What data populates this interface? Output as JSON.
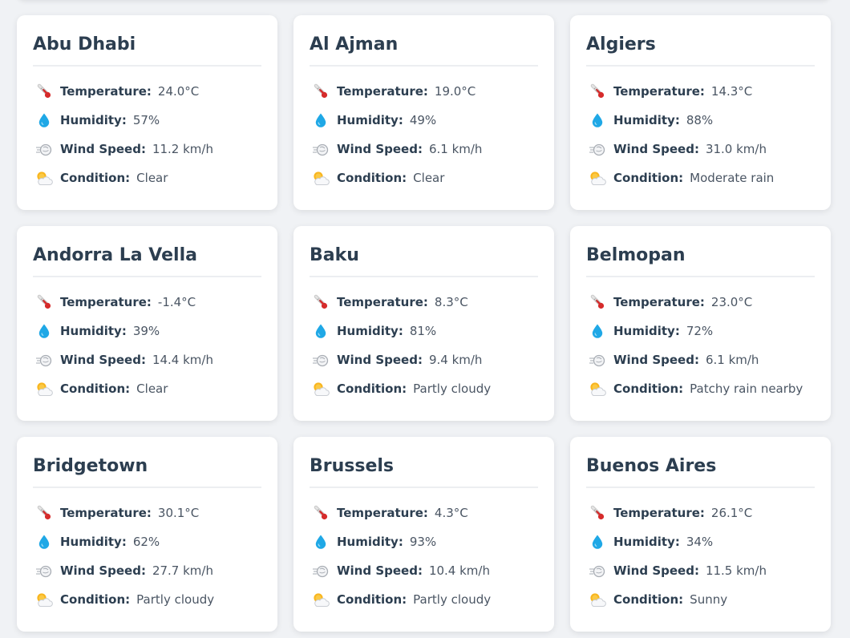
{
  "labels": {
    "temperature": "Temperature:",
    "humidity": "Humidity:",
    "wind_speed": "Wind Speed:",
    "condition": "Condition:"
  },
  "icons": {
    "temperature": "thermometer-icon",
    "humidity": "droplet-icon",
    "wind_speed": "wind-icon",
    "condition": "sun-behind-cloud-icon"
  },
  "colors": {
    "background": "#f0f2f5",
    "card": "#ffffff",
    "heading": "#2c3e50"
  },
  "cities": [
    {
      "name": "Abu Dhabi",
      "temperature": "24.0°C",
      "humidity": "57%",
      "wind_speed": "11.2 km/h",
      "condition": "Clear"
    },
    {
      "name": "Al Ajman",
      "temperature": "19.0°C",
      "humidity": "49%",
      "wind_speed": "6.1 km/h",
      "condition": "Clear"
    },
    {
      "name": "Algiers",
      "temperature": "14.3°C",
      "humidity": "88%",
      "wind_speed": "31.0 km/h",
      "condition": "Moderate rain"
    },
    {
      "name": "Andorra La Vella",
      "temperature": "-1.4°C",
      "humidity": "39%",
      "wind_speed": "14.4 km/h",
      "condition": "Clear"
    },
    {
      "name": "Baku",
      "temperature": "8.3°C",
      "humidity": "81%",
      "wind_speed": "9.4 km/h",
      "condition": "Partly cloudy"
    },
    {
      "name": "Belmopan",
      "temperature": "23.0°C",
      "humidity": "72%",
      "wind_speed": "6.1 km/h",
      "condition": "Patchy rain nearby"
    },
    {
      "name": "Bridgetown",
      "temperature": "30.1°C",
      "humidity": "62%",
      "wind_speed": "27.7 km/h",
      "condition": "Partly cloudy"
    },
    {
      "name": "Brussels",
      "temperature": "4.3°C",
      "humidity": "93%",
      "wind_speed": "10.4 km/h",
      "condition": "Partly cloudy"
    },
    {
      "name": "Buenos Aires",
      "temperature": "26.1°C",
      "humidity": "34%",
      "wind_speed": "11.5 km/h",
      "condition": "Sunny"
    }
  ]
}
